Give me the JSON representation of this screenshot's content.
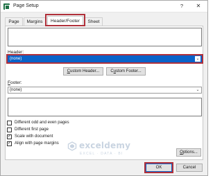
{
  "window": {
    "title": "Page Setup",
    "help_label": "?",
    "close_label": "✕"
  },
  "tabs": [
    {
      "label": "Page",
      "active": false
    },
    {
      "label": "Margins",
      "active": false
    },
    {
      "label": "Header/Footer",
      "active": true
    },
    {
      "label": "Sheet",
      "active": false
    }
  ],
  "header": {
    "label": "Header:",
    "value": "(none)"
  },
  "buttons": {
    "custom_header": "Custom Header...",
    "custom_footer": "Custom Footer...",
    "options": "Options...",
    "ok": "OK",
    "cancel": "Cancel"
  },
  "footer": {
    "label": "Footer:",
    "value": "(none)"
  },
  "checkboxes": [
    {
      "label": "Different odd and even pages",
      "checked": false
    },
    {
      "label": "Different first page",
      "checked": false
    },
    {
      "label": "Scale with document",
      "checked": true
    },
    {
      "label": "Align with page margins",
      "checked": true
    }
  ],
  "watermark": {
    "name": "exceldemy",
    "tagline": "EXCEL · DATA · BI"
  },
  "colors": {
    "highlight": "#b0303a",
    "selection": "#0a63c9"
  }
}
